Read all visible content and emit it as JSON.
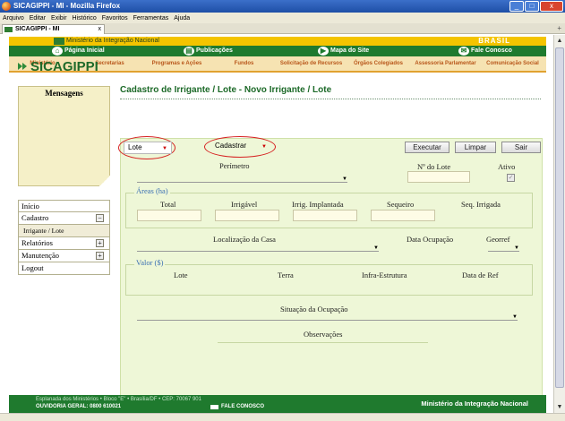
{
  "window": {
    "title": "SICAGIPPI - MI - Mozilla Firefox",
    "min": "_",
    "max": "□",
    "close": "x"
  },
  "menu": [
    "Arquivo",
    "Editar",
    "Exibir",
    "Histórico",
    "Favoritos",
    "Ferramentas",
    "Ajuda"
  ],
  "tab": {
    "title": "SICAGIPPI - MI",
    "close": "x",
    "new": "+"
  },
  "gov": {
    "ministry": "Ministério da Integração Nacional",
    "brasil": "BRASIL"
  },
  "topnav": {
    "home": "Página Inicial",
    "publications": "Publicações",
    "sitemap": "Mapa do Site",
    "contact": "Fale Conosco"
  },
  "orangenav": [
    "Ministério",
    "Secretarias",
    "Programas e Ações",
    "Fundos",
    "Solicitação de Recursos",
    "Órgãos Colegiados",
    "Assessoria Parlamentar",
    "Comunicação Social"
  ],
  "brand": "SICAGIPPI",
  "messages_title": "Mensagens",
  "sidebar": {
    "items": [
      {
        "label": "Início"
      },
      {
        "label": "Cadastro",
        "toggle": "−"
      },
      {
        "label": "Irrigante / Lote"
      },
      {
        "label": "Relatórios",
        "toggle": "+"
      },
      {
        "label": "Manutenção",
        "toggle": "+"
      },
      {
        "label": "Logout"
      }
    ]
  },
  "form": {
    "title": "Cadastro de Irrigante / Lote - Novo Irrigante / Lote",
    "entity_select": "Lote",
    "action_select": "Cadastrar",
    "buttons": {
      "execute": "Executar",
      "clear": "Limpar",
      "exit": "Sair"
    },
    "perimetro": "Perímetro",
    "numero_lote": "Nº do Lote",
    "ativo": "Ativo",
    "ativo_check": "✓",
    "areas": {
      "legend": "Áreas (ha)",
      "total": "Total",
      "irrigavel": "Irrigável",
      "irrig_implantada": "Irrig. Implantada",
      "sequeiro": "Sequeiro",
      "seq_irrigada": "Seq. Irrigada"
    },
    "localizacao": "Localização da Casa",
    "data_ocupacao": "Data Ocupação",
    "georref": "Georref",
    "valor": {
      "legend": "Valor ($)",
      "lote": "Lote",
      "terra": "Terra",
      "infra": "Infra-Estrutura",
      "data_ref": "Data de Ref"
    },
    "situacao": "Situação da Ocupação",
    "observacoes": "Observações"
  },
  "footer": {
    "address": "Esplanada dos Ministérios • Bloco \"E\" • Brasília/DF • CEP: 70067 901",
    "ouvidoria": "OUVIDORIA GERAL: 0800 610021",
    "contact": "FALE CONOSCO",
    "ministry": "Ministério da Integração Nacional"
  },
  "colors": {
    "green": "#1f7a2e",
    "yellow": "#f4c400",
    "orange_text": "#b8561a",
    "form_bg": "#eef7d7"
  }
}
